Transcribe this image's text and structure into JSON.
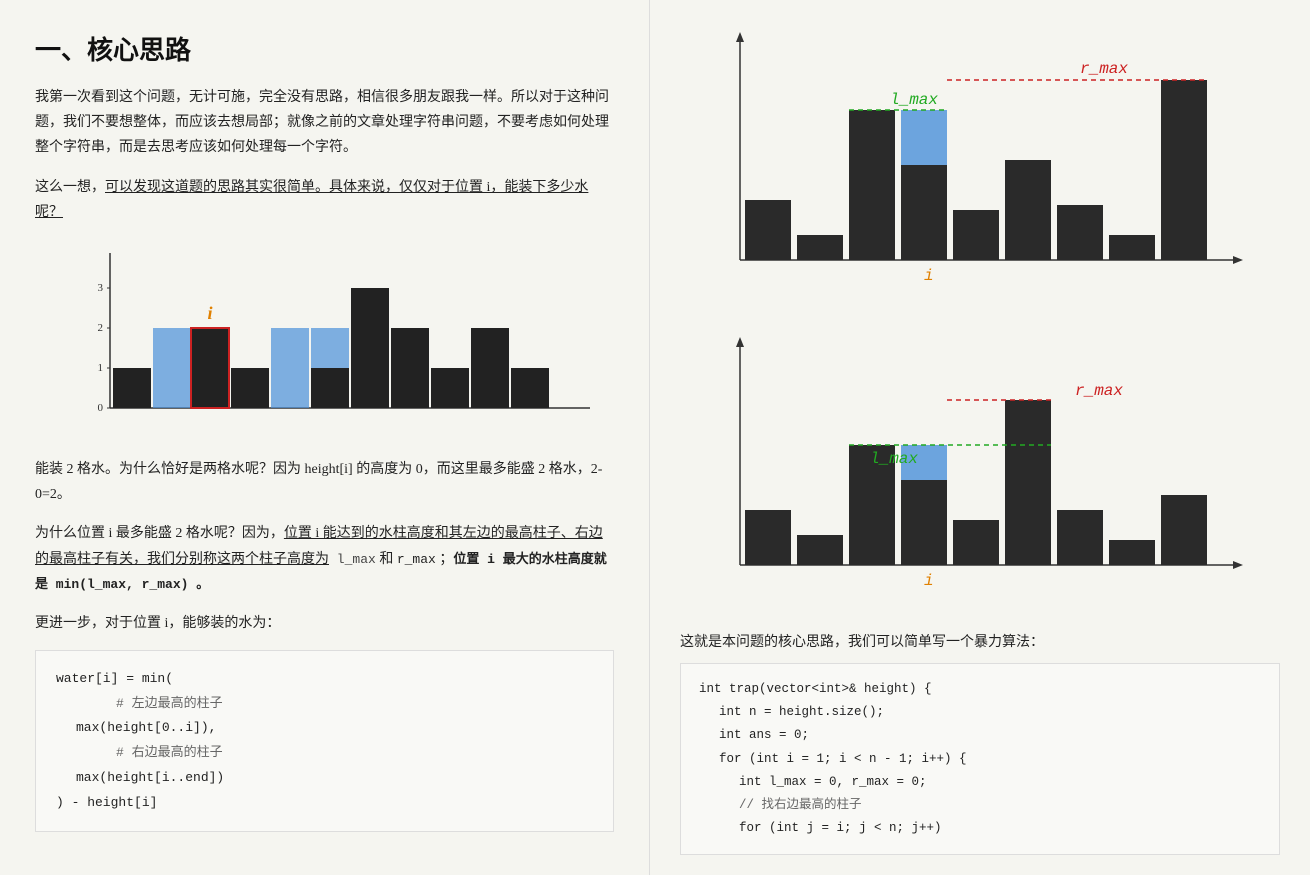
{
  "left": {
    "title": "一、核心思路",
    "para1": "我第一次看到这个问题，无计可施，完全没有思路，相信很多朋友跟我一样。所以对于这种问题，我们不要想整体，而应该去想局部；就像之前的文章处理字符串问题，不要考虑如何处理整个字符串，而是去思考应该如何处理每一个字符。",
    "para2_before": "这么一想，",
    "para2_underline": "可以发现这道题的思路其实很简单。具体来说，仅仅对于位置 i，能装下多少水呢？",
    "para3": "能装 2 格水。为什么恰好是两格水呢？因为 height[i] 的高度为 0，而这里最多能盛 2 格水，2-0=2。",
    "para4_before": "为什么位置 i 最多能盛 2 格水呢？因为，",
    "para4_underline": "位置 i 能达到的水柱高度和其左边的最高柱子、右边的最高柱子有关，我们分别称这两个柱子高度为",
    "para4_lmax": " l_max",
    "para4_mid": " 和 ",
    "para4_rmax": "r_max",
    "para4_end": " ；",
    "para4_bold": "位置 i 最大的水柱高度就是  min(l_max, r_max) 。",
    "para5": "更进一步，对于位置 i，能够装的水为：",
    "code": {
      "line1": "water[i] = min(",
      "line2_comment": "# 左边最高的柱子",
      "line3": "    max(height[0..i]),",
      "line4_comment": "# 右边最高的柱子",
      "line5": "    max(height[i..end])",
      "line6": ") - height[i]"
    }
  },
  "right": {
    "diagram1": {
      "label_lmax": "l_max",
      "label_rmax": "r_max",
      "label_i": "i"
    },
    "diagram2": {
      "label_lmax": "l_max",
      "label_rmax": "r_max",
      "label_i": "i"
    },
    "para_before_code": "这就是本问题的核心思路，我们可以简单写一个暴力算法：",
    "code_lines": [
      "int trap(vector<int>& height) {",
      "    int n = height.size();",
      "    int ans = 0;",
      "    for (int i = 1; i < n - 1; i++) {",
      "        int l_max = 0, r_max = 0;",
      "        // 找右边最高的柱子",
      "        for (int j = i; j < n; j++)"
    ]
  }
}
